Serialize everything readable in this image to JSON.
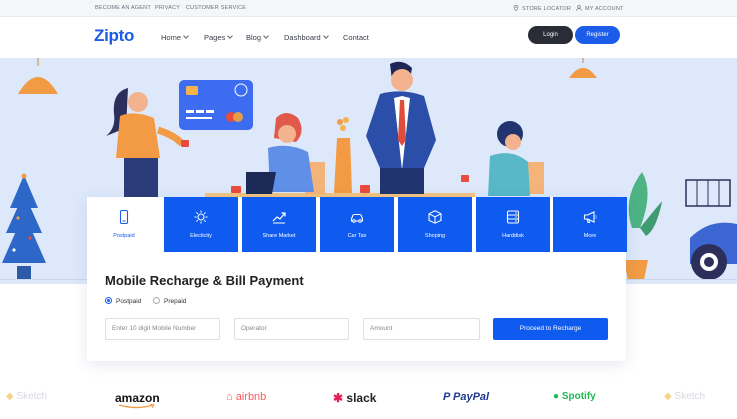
{
  "topbar": {
    "links": [
      "BECOME AN AGENT",
      "PRIVACY",
      "CUSTOMER SERVICE"
    ],
    "store_locator": "STORE LOCATOR",
    "my_account": "MY ACCOUNT"
  },
  "header": {
    "logo": "Zipto",
    "nav": [
      "Home",
      "Pages",
      "Blog",
      "Dashboard",
      "Contact"
    ],
    "login": "Login",
    "register": "Register"
  },
  "card": {
    "tabs": [
      {
        "label": "Postpaid",
        "icon": "phone-icon"
      },
      {
        "label": "Electicity",
        "icon": "bulb-icon"
      },
      {
        "label": "Share Market",
        "icon": "trend-icon"
      },
      {
        "label": "Car Tax",
        "icon": "car-icon"
      },
      {
        "label": "Shoping",
        "icon": "box-icon"
      },
      {
        "label": "Harddisk",
        "icon": "harddisk-icon"
      },
      {
        "label": "More",
        "icon": "megaphone-icon"
      }
    ],
    "title": "Mobile Recharge & Bill Payment",
    "radio_postpaid": "Postpaid",
    "radio_prepaid": "Prepaid",
    "mobile_placeholder": "Enter 10 digit Mobile Number",
    "operator_placeholder": "Operator",
    "amount_placeholder": "Amount",
    "proceed": "Proceed to Recharge"
  },
  "brands": [
    "Sketch",
    "amazon",
    "airbnb",
    "slack",
    "PayPal",
    "Spotify",
    "Sketch"
  ],
  "colors": {
    "primary": "#0f5bf0",
    "dark": "#2a2d36",
    "hero_bg": "#dde8fa",
    "accent_orange": "#f29b44"
  }
}
